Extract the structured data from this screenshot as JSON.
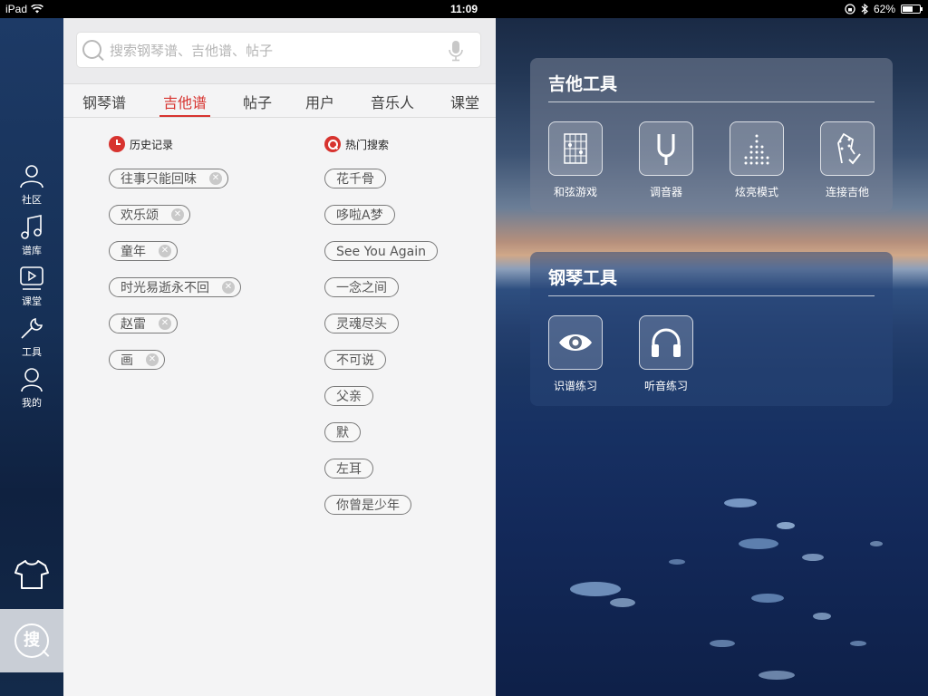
{
  "status_bar": {
    "device": "iPad",
    "time": "11:09",
    "battery": "62%",
    "battery_level": 0.62
  },
  "sidebar": {
    "items": [
      {
        "label": "社区",
        "icon": "people-icon"
      },
      {
        "label": "谱库",
        "icon": "music-note-icon"
      },
      {
        "label": "课堂",
        "icon": "video-play-icon"
      },
      {
        "label": "工具",
        "icon": "wrench-icon"
      },
      {
        "label": "我的",
        "icon": "person-icon"
      }
    ],
    "shirt_icon": "tshirt-icon",
    "search_glyph": "搜"
  },
  "search": {
    "placeholder": "搜索钢琴谱、吉他谱、帖子",
    "value": ""
  },
  "tabs": [
    {
      "label": "钢琴谱",
      "active": false
    },
    {
      "label": "吉他谱",
      "active": true
    },
    {
      "label": "帖子",
      "active": false
    },
    {
      "label": "用户",
      "active": false
    },
    {
      "label": "音乐人",
      "active": false
    },
    {
      "label": "课堂",
      "active": false
    }
  ],
  "history": {
    "title": "历史记录",
    "items": [
      "往事只能回味",
      "欢乐颂",
      "童年",
      "时光易逝永不回",
      "赵雷",
      "画"
    ]
  },
  "hot": {
    "title": "热门搜索",
    "items": [
      "花千骨",
      "哆啦A梦",
      "See You Again",
      "一念之间",
      "灵魂尽头",
      "不可说",
      "父亲",
      "默",
      "左耳",
      "你曾是少年"
    ]
  },
  "guitar_tools": {
    "title": "吉他工具",
    "tools": [
      {
        "label": "和弦游戏",
        "icon": "chord-grid-icon"
      },
      {
        "label": "调音器",
        "icon": "tuning-fork-icon"
      },
      {
        "label": "炫亮模式",
        "icon": "dot-pattern-icon"
      },
      {
        "label": "连接吉他",
        "icon": "guitar-headstock-icon"
      }
    ]
  },
  "piano_tools": {
    "title": "钢琴工具",
    "tools": [
      {
        "label": "识谱练习",
        "icon": "eye-icon"
      },
      {
        "label": "听音练习",
        "icon": "headphones-icon"
      }
    ]
  },
  "colors": {
    "accent": "#d7332f",
    "panel_bg": "#f4f4f5",
    "sidebar_bg": "#163056"
  }
}
